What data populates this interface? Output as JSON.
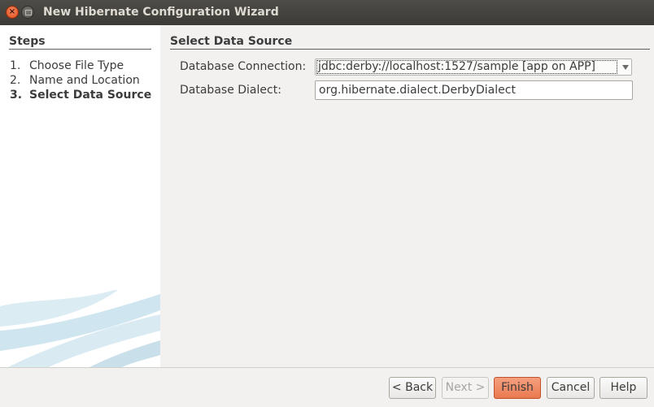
{
  "window": {
    "title": "New Hibernate Configuration Wizard"
  },
  "steps": {
    "heading": "Steps",
    "items": [
      {
        "num": "1.",
        "label": "Choose File Type",
        "current": false
      },
      {
        "num": "2.",
        "label": "Name and Location",
        "current": false
      },
      {
        "num": "3.",
        "label": "Select Data Source",
        "current": true
      }
    ]
  },
  "main": {
    "heading": "Select Data Source",
    "connection_label": "Database Connection:",
    "connection_value": "jdbc:derby://localhost:1527/sample [app on APP]",
    "dialect_label": "Database Dialect:",
    "dialect_value": "org.hibernate.dialect.DerbyDialect"
  },
  "buttons": {
    "back": "< Back",
    "next": "Next >",
    "finish": "Finish",
    "cancel": "Cancel",
    "help": "Help"
  },
  "colors": {
    "titlebar": "#3c3b37",
    "close_button": "#df4a16",
    "finish_accent": "#ea7a50",
    "panel_bg": "#f2f1f0"
  }
}
